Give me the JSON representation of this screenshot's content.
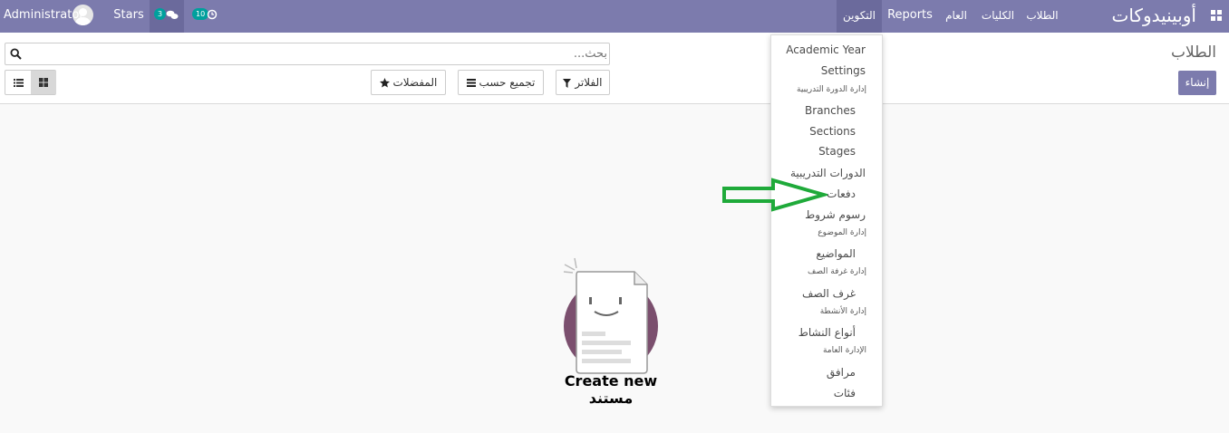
{
  "navbar": {
    "brand": "أوبينيدوكات",
    "menus": [
      "الطلاب",
      "الكليات",
      "العام",
      "Reports",
      "التكوين"
    ],
    "activity_badge": "10",
    "messages_badge": "3",
    "stars": "Stars",
    "username": "Administrator",
    "colors": {
      "bar": "#7c7bad",
      "badge": "#00a09d"
    }
  },
  "control_panel": {
    "breadcrumb": "الطلاب",
    "create_label": "إنشاء",
    "search_placeholder": "بحث...",
    "filters_label": "الفلاتر",
    "group_by_label": "تجميع حسب",
    "favorites_label": "المفضلات"
  },
  "empty_state": {
    "text": "Create new مستند"
  },
  "dropdown": {
    "items": [
      {
        "label": "Academic Year",
        "type": "item"
      },
      {
        "label": "Settings",
        "type": "item"
      },
      {
        "label": "إدارة الدورة التدريبية",
        "type": "header"
      },
      {
        "label": "Branches",
        "type": "sub"
      },
      {
        "label": "Sections",
        "type": "sub"
      },
      {
        "label": "Stages",
        "type": "sub"
      },
      {
        "label": "الدورات التدريبية",
        "type": "item"
      },
      {
        "label": "دفعات",
        "type": "sub"
      },
      {
        "label": "رسوم شروط",
        "type": "item"
      },
      {
        "label": "إدارة الموضوع",
        "type": "header"
      },
      {
        "label": "المواضيع",
        "type": "sub"
      },
      {
        "label": "إدارة غرفة الصف",
        "type": "header"
      },
      {
        "label": "غرف الصف",
        "type": "sub"
      },
      {
        "label": "إدارة الأنشطة",
        "type": "header"
      },
      {
        "label": "أنواع النشاط",
        "type": "sub"
      },
      {
        "label": "الإدارة العامة",
        "type": "header"
      },
      {
        "label": "مرافق",
        "type": "sub"
      },
      {
        "label": "فئات",
        "type": "sub"
      }
    ]
  },
  "annotation": {
    "arrow_color": "#1faa3a"
  }
}
